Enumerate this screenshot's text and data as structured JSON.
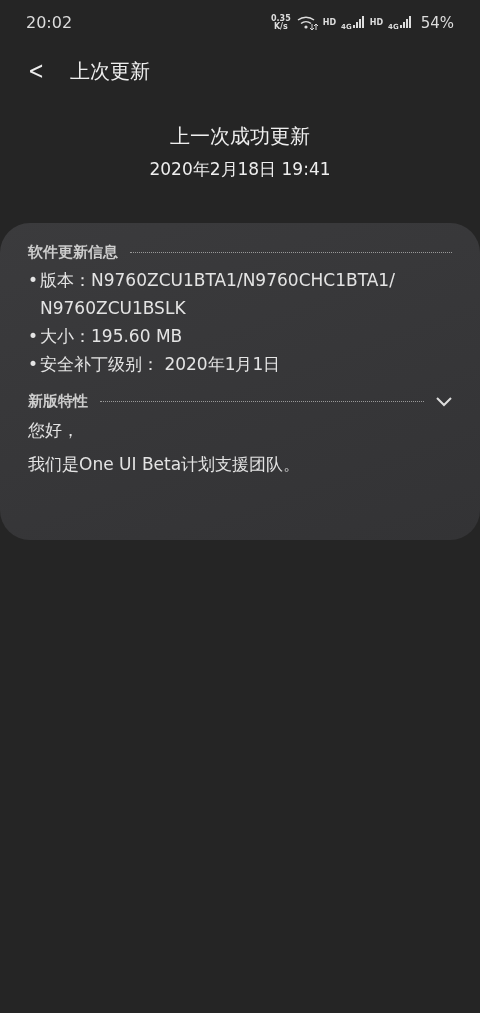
{
  "status_bar": {
    "time": "20:02",
    "net_speed": [
      "0.35",
      "K/s"
    ],
    "networks": [
      {
        "label": "HD",
        "type": "4G"
      },
      {
        "label": "HD",
        "type": "4G"
      }
    ],
    "battery": "54%"
  },
  "header": {
    "back": "<",
    "title": "上次更新"
  },
  "summary": {
    "heading": "上一次成功更新",
    "date": "2020年2月18日 19:41"
  },
  "card": {
    "info": {
      "title": "软件更新信息",
      "items": [
        {
          "bullet": "•",
          "text": "版本：N9760ZCU1BTA1/N9760CHC1BTA1/ N9760ZCU1BSLK"
        },
        {
          "bullet": "•",
          "text": "大小：195.60 MB"
        },
        {
          "bullet": "•",
          "text": "安全补丁级别： 2020年1月1日"
        }
      ]
    },
    "features": {
      "title": "新版特性",
      "paragraphs": [
        "您好，",
        "我们是One UI Beta计划支援团队。"
      ]
    }
  }
}
